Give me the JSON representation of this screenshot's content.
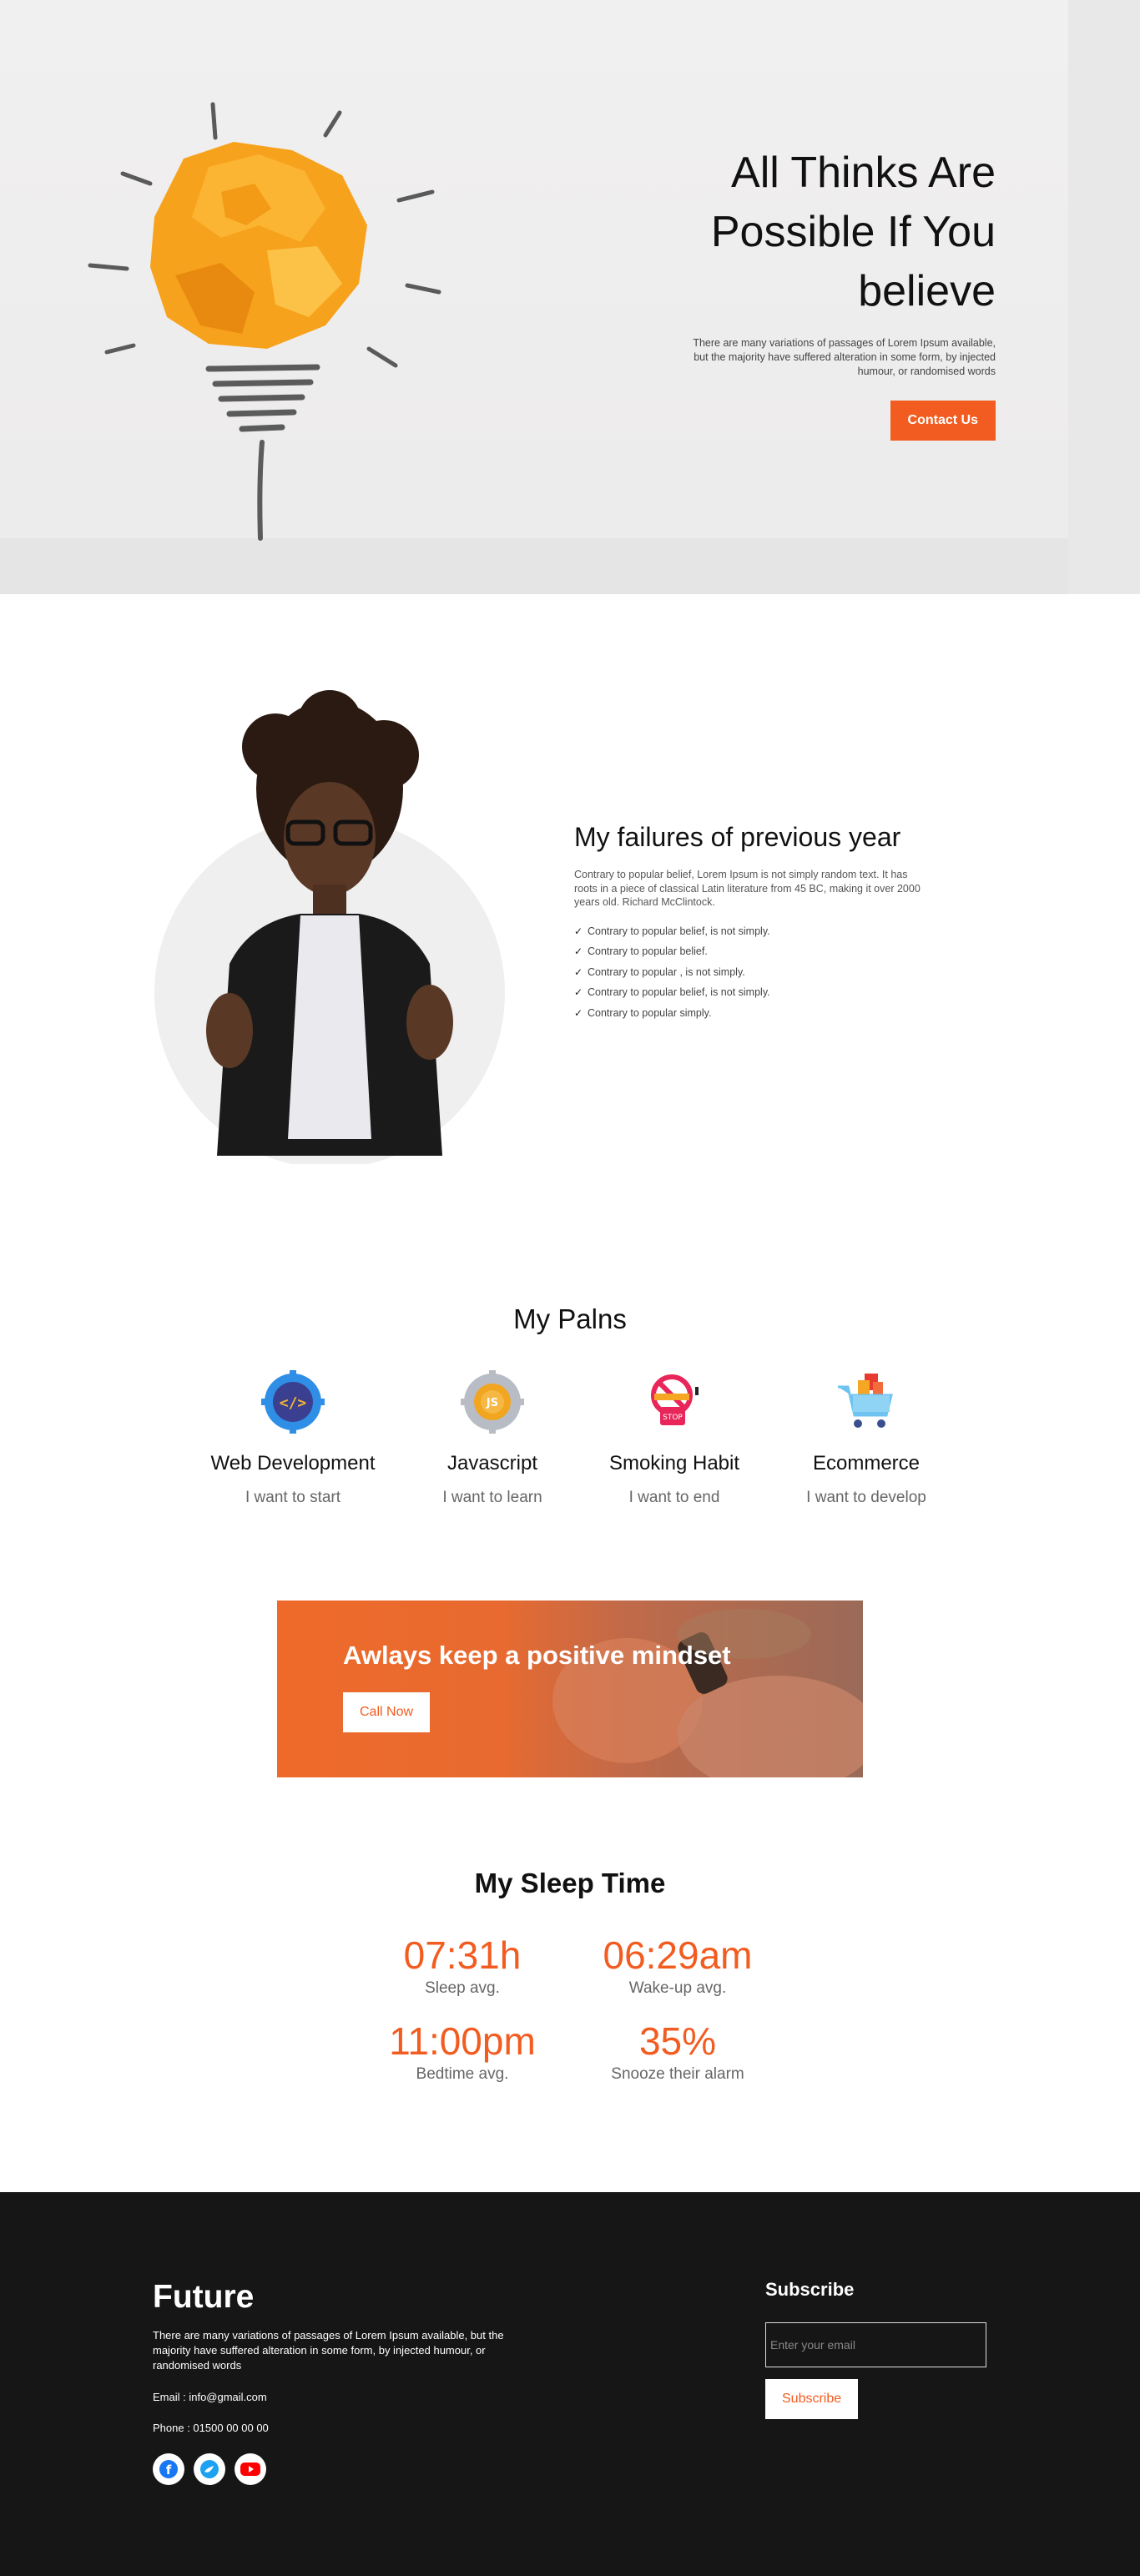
{
  "hero": {
    "title_line1": "All Thinks Are",
    "title_line2": "Possible If You",
    "title_line3": "believe",
    "subtitle": "There are many variations of passages of Lorem Ipsum available, but the majority have suffered alteration in some form, by injected humour, or randomised words",
    "button": "Contact Us"
  },
  "failures": {
    "title": "My failures of previous year",
    "description": "Contrary to popular belief, Lorem Ipsum is not simply random text. It has roots in a piece of classical Latin literature from 45 BC, making it over 2000 years old. Richard McClintock.",
    "items": [
      "Contrary to popular belief, is not simply.",
      "Contrary to popular belief.",
      "Contrary to popular , is not simply.",
      "Contrary to popular belief, is not simply.",
      "Contrary to popular simply."
    ]
  },
  "plans": {
    "title": "My Palns",
    "items": [
      {
        "icon": "code-gear-icon",
        "title": "Web Development",
        "sub": "I want to start"
      },
      {
        "icon": "js-gear-icon",
        "title": "Javascript",
        "sub": "I want to learn"
      },
      {
        "icon": "no-smoking-icon",
        "title": "Smoking Habit",
        "sub": "I want to end"
      },
      {
        "icon": "shopping-cart-icon",
        "title": "Ecommerce",
        "sub": "I want to develop"
      }
    ]
  },
  "banner": {
    "title": "Awlays keep a positive mindset",
    "button": "Call Now"
  },
  "sleep": {
    "title": "My Sleep Time",
    "stats": [
      {
        "value": "07:31h",
        "label": "Sleep avg."
      },
      {
        "value": "06:29am",
        "label": "Wake-up avg."
      },
      {
        "value": "11:00pm",
        "label": "Bedtime avg."
      },
      {
        "value": "35%",
        "label": "Snooze their alarm"
      }
    ]
  },
  "footer": {
    "brand": "Future",
    "description": "There are many variations of passages of Lorem Ipsum available, but the majority have suffered alteration in some form, by injected humour, or randomised words",
    "email": "Email : info@gmail.com",
    "phone": "Phone : 01500 00 00 00",
    "subscribe_title": "Subscribe",
    "input_placeholder": "Enter your email",
    "subscribe_button": "Subscribe"
  },
  "colors": {
    "accent": "#f25c20",
    "footer_bg": "#161616"
  }
}
